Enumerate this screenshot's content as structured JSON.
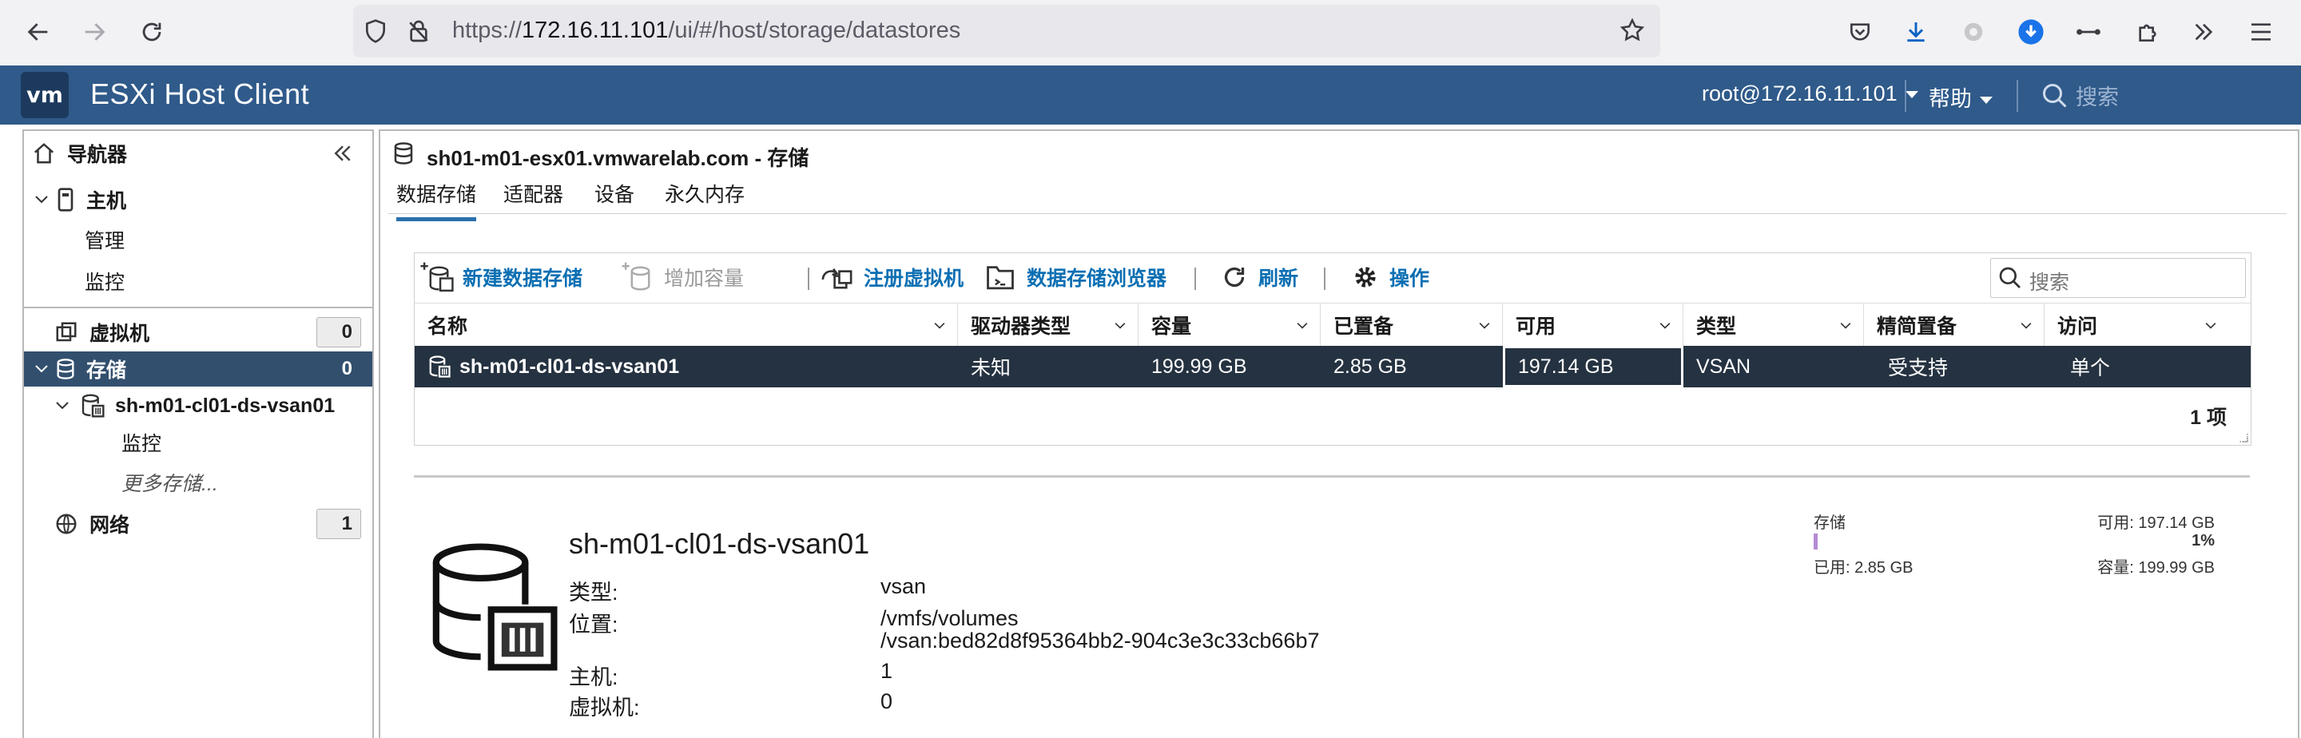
{
  "browser": {
    "url_prefix": "https://",
    "url_host": "172.16.11.101",
    "url_path": "/ui/#/host/storage/datastores"
  },
  "header": {
    "logo": "vm",
    "title": "ESXi Host Client",
    "user": "root@172.16.11.101",
    "help": "帮助",
    "search_placeholder": "搜索"
  },
  "sidebar": {
    "title": "导航器",
    "host": "主机",
    "host_items": [
      "管理",
      "监控"
    ],
    "vms": {
      "label": "虚拟机",
      "count": "0"
    },
    "storage": {
      "label": "存储",
      "count": "0"
    },
    "datastore": "sh-m01-cl01-ds-vsan01",
    "datastore_child": "监控",
    "more_storage": "更多存储...",
    "network": {
      "label": "网络",
      "count": "1"
    }
  },
  "main": {
    "title": "sh01-m01-esx01.vmwarelab.com - 存储",
    "tabs": [
      "数据存储",
      "适配器",
      "设备",
      "永久内存"
    ],
    "active_tab": 0
  },
  "toolbar": {
    "new_datastore": "新建数据存储",
    "increase_capacity": "增加容量",
    "register_vm": "注册虚拟机",
    "datastore_browser": "数据存储浏览器",
    "refresh": "刷新",
    "actions": "操作",
    "search_placeholder": "搜索"
  },
  "table": {
    "columns": [
      "名称",
      "驱动器类型",
      "容量",
      "已置备",
      "可用",
      "类型",
      "精简置备",
      "访问"
    ],
    "rows": [
      [
        "sh-m01-cl01-ds-vsan01",
        "未知",
        "199.99 GB",
        "2.85 GB",
        "197.14 GB",
        "VSAN",
        "受支持",
        "单个"
      ]
    ],
    "count_label": "1 项"
  },
  "details": {
    "name": "sh-m01-cl01-ds-vsan01",
    "type_label": "类型:",
    "type_value": "vsan",
    "location_label": "位置:",
    "location_line1": "/vmfs/volumes",
    "location_line2": "/vsan:bed82d8f95364bb2-904c3e3c33cb66b7",
    "hosts_label": "主机:",
    "hosts_value": "1",
    "vms_label": "虚拟机:",
    "vms_value": "0"
  },
  "storage_summary": {
    "label": "存储",
    "free": "可用: 197.14 GB",
    "percent": "1%",
    "used": "已用: 2.85 GB",
    "capacity": "容量: 199.99 GB",
    "used_fraction": 0.01
  },
  "colors": {
    "header_bg": "#2f5a8a",
    "selected_row": "#253241",
    "sidebar_selected": "#324f6e",
    "link_blue": "#0b6fb3",
    "usage_bar": "#b48ad6"
  }
}
